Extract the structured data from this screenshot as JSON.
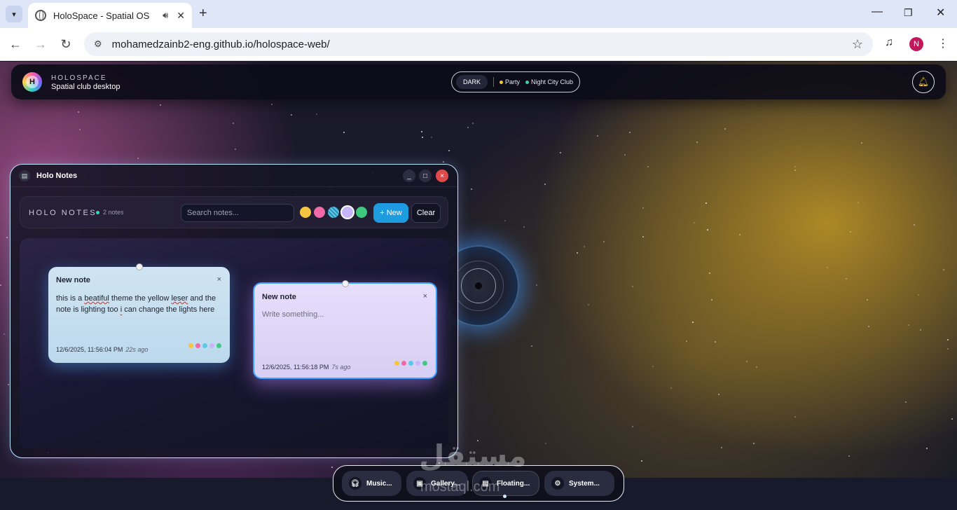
{
  "browser": {
    "tab_title": "HoloSpace - Spatial OS",
    "url": "mohamedzainb2-eng.github.io/holospace-web/",
    "profile_initial": "N"
  },
  "topbar": {
    "brand": "HOLOSPACE",
    "subtitle": "Spatial club desktop",
    "logo_letter": "H",
    "mode": "DARK",
    "status_chips": [
      {
        "label": "Party",
        "color": "#f5c542"
      },
      {
        "label": "Night City Club",
        "color": "#3ad1b5"
      }
    ]
  },
  "notes_window": {
    "title": "Holo Notes",
    "minimize": "_",
    "maximize": "□",
    "close": "×",
    "header_title": "HOLO NOTES",
    "count": "2 notes",
    "search_placeholder": "Search notes...",
    "new_label": "+ New",
    "clear_label": "Clear",
    "color_swatches": [
      {
        "color": "#f5c542",
        "selected": false
      },
      {
        "color": "#f06aa8",
        "selected": false
      },
      {
        "color": "#5ac8e8",
        "selected": false
      },
      {
        "color": "#c7b4ff",
        "selected": true
      },
      {
        "color": "#3ec97f",
        "selected": false
      }
    ],
    "notes": [
      {
        "title": "New note",
        "body_parts": [
          "this is a ",
          "beatiful",
          " theme the yellow ",
          "leser",
          " and the note is lighting too ",
          "i",
          " can change the lights here"
        ],
        "date": "12/6/2025, 11:56:04 PM",
        "ago": "22s ago",
        "close": "×"
      },
      {
        "title": "New note",
        "placeholder": "Write something...",
        "date": "12/6/2025, 11:56:18 PM",
        "ago": "7s ago",
        "close": "×"
      }
    ]
  },
  "dock": {
    "items": [
      {
        "label": "Music...",
        "icon": "headphones-icon"
      },
      {
        "label": "Gallery...",
        "icon": "image-icon"
      },
      {
        "label": "Floating...",
        "icon": "note-icon"
      },
      {
        "label": "System...",
        "icon": "gear-icon"
      }
    ]
  },
  "watermark": {
    "text": "مستقل",
    "sub": "mostaql.com"
  }
}
